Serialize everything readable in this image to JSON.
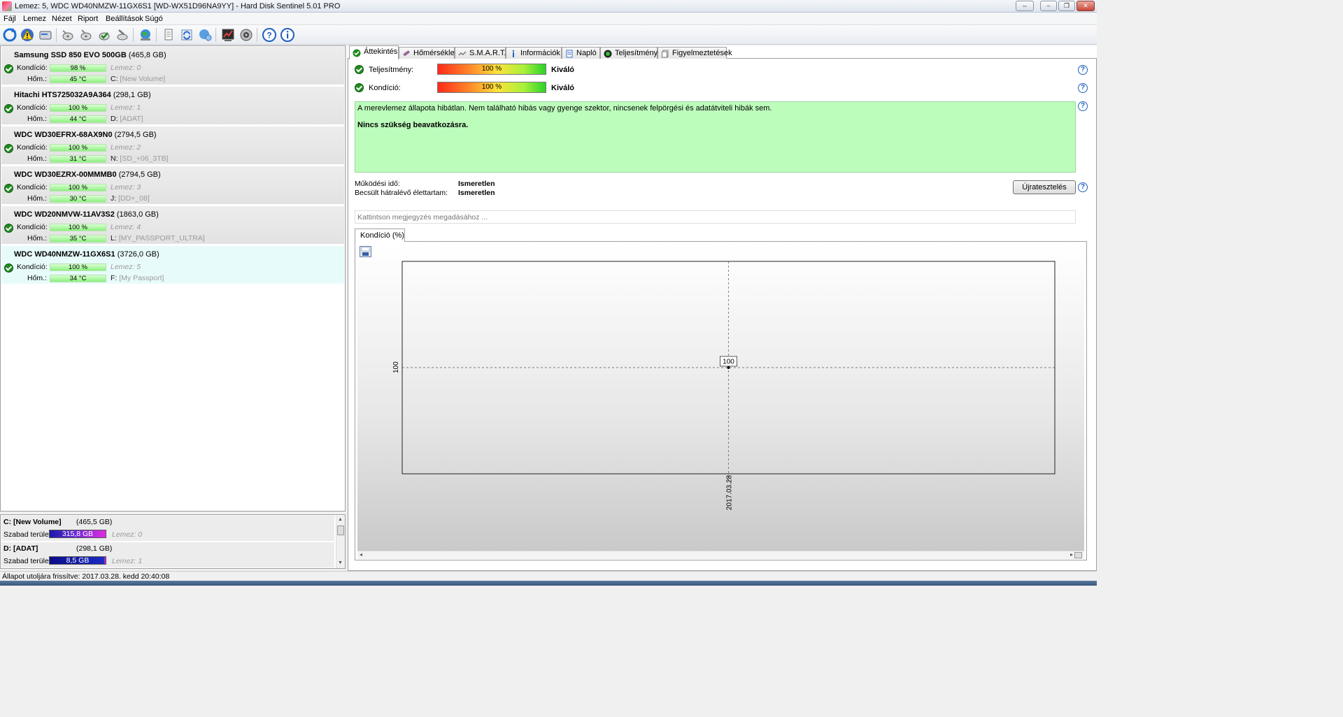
{
  "window": {
    "title": "Lemez: 5, WDC WD40NMZW-11GX6S1 [WD-WX51D96NA9YY]  -  Hard Disk Sentinel 5.01 PRO"
  },
  "menu": [
    "Fájl",
    "Lemez",
    "Nézet",
    "Riport",
    "Beállítások",
    "Súgó"
  ],
  "disks": [
    {
      "name": "Samsung SSD 850 EVO 500GB",
      "size": "(465,8 GB)",
      "condition_label": "Kondíció:",
      "condition": "98 %",
      "condition_value": 98,
      "temp_label": "Hőm.:",
      "temp": "45 °C",
      "disk_index": "Lemez: 0",
      "drive": "C:",
      "volume": "[New Volume]"
    },
    {
      "name": "Hitachi HTS725032A9A364",
      "size": "(298,1 GB)",
      "condition_label": "Kondíció:",
      "condition": "100 %",
      "condition_value": 100,
      "temp_label": "Hőm.:",
      "temp": "44 °C",
      "disk_index": "Lemez: 1",
      "drive": "D:",
      "volume": "[ADAT]"
    },
    {
      "name": "WDC WD30EFRX-68AX9N0",
      "size": "(2794,5 GB)",
      "condition_label": "Kondíció:",
      "condition": "100 %",
      "condition_value": 100,
      "temp_label": "Hőm.:",
      "temp": "31 °C",
      "disk_index": "Lemez: 2",
      "drive": "N:",
      "volume": "[SD_+06_3TB]"
    },
    {
      "name": "WDC WD30EZRX-00MMMB0",
      "size": "(2794,5 GB)",
      "condition_label": "Kondíció:",
      "condition": "100 %",
      "condition_value": 100,
      "temp_label": "Hőm.:",
      "temp": "30 °C",
      "disk_index": "Lemez: 3",
      "drive": "J:",
      "volume": "[DD+_08]"
    },
    {
      "name": "WDC WD20NMVW-11AV3S2",
      "size": "(1863,0 GB)",
      "condition_label": "Kondíció:",
      "condition": "100 %",
      "condition_value": 100,
      "temp_label": "Hőm.:",
      "temp": "35 °C",
      "disk_index": "Lemez: 4",
      "drive": "L:",
      "volume": "[MY_PASSPORT_ULTRA]"
    },
    {
      "name": "WDC WD40NMZW-11GX6S1",
      "size": "(3726,0 GB)",
      "condition_label": "Kondíció:",
      "condition": "100 %",
      "condition_value": 100,
      "temp_label": "Hőm.:",
      "temp": "34 °C",
      "disk_index": "Lemez: 5",
      "drive": "F:",
      "volume": "[My Passport]",
      "selected": true
    }
  ],
  "volumes": [
    {
      "name": "C: [New Volume]",
      "size": "(465,5 GB)",
      "free_label": "Szabad terület",
      "free": "315,8 GB",
      "disk_index": "Lemez: 0",
      "bar_color": "#d21fd2"
    },
    {
      "name": "D: [ADAT]",
      "size": "(298,1 GB)",
      "free_label": "Szabad terület",
      "free": "8,5 GB",
      "disk_index": "Lemez: 1",
      "bar_color": "#1a1aa8"
    }
  ],
  "tabs": [
    "Áttekintés",
    "Hőmérséklet",
    "S.M.A.R.T.",
    "Információk",
    "Napló",
    "Teljesítmény",
    "Figyelmeztetések"
  ],
  "overview": {
    "performance_label": "Teljesítmény:",
    "performance_value": "100 %",
    "performance_text": "Kiváló",
    "condition_label": "Kondíció:",
    "condition_value": "100 %",
    "condition_text": "Kiváló",
    "message_line1": "A merevlemez állapota hibátlan. Nem található hibás vagy gyenge szektor, nincsenek felpörgési és adatátviteli hibák sem.",
    "message_line2": "Nincs szükség beavatkozásra.",
    "uptime_label": "Működési idő:",
    "uptime_value": "Ismeretlen",
    "lifetime_label": "Becsült hátralévő élettartam:",
    "lifetime_value": "Ismeretlen",
    "retest_button": "Újratesztelés",
    "note_placeholder": "Kattintson megjegyzés megadásához ...",
    "chart_tab": "Kondíció  (%)"
  },
  "chart_data": {
    "type": "line",
    "x": [
      "2017.03.28"
    ],
    "series": [
      {
        "values": [
          100
        ]
      }
    ],
    "y_tick_labels": [
      "100"
    ],
    "data_labels": [
      "100"
    ],
    "grid": true
  },
  "status": {
    "text": "Állapot utoljára frissítve: 2017.03.28. kedd 20:40:08"
  },
  "colors": {
    "ok": "#1f8a1f",
    "message_bg": "#bdfdbc",
    "condition_bar": "#8ef07f"
  }
}
